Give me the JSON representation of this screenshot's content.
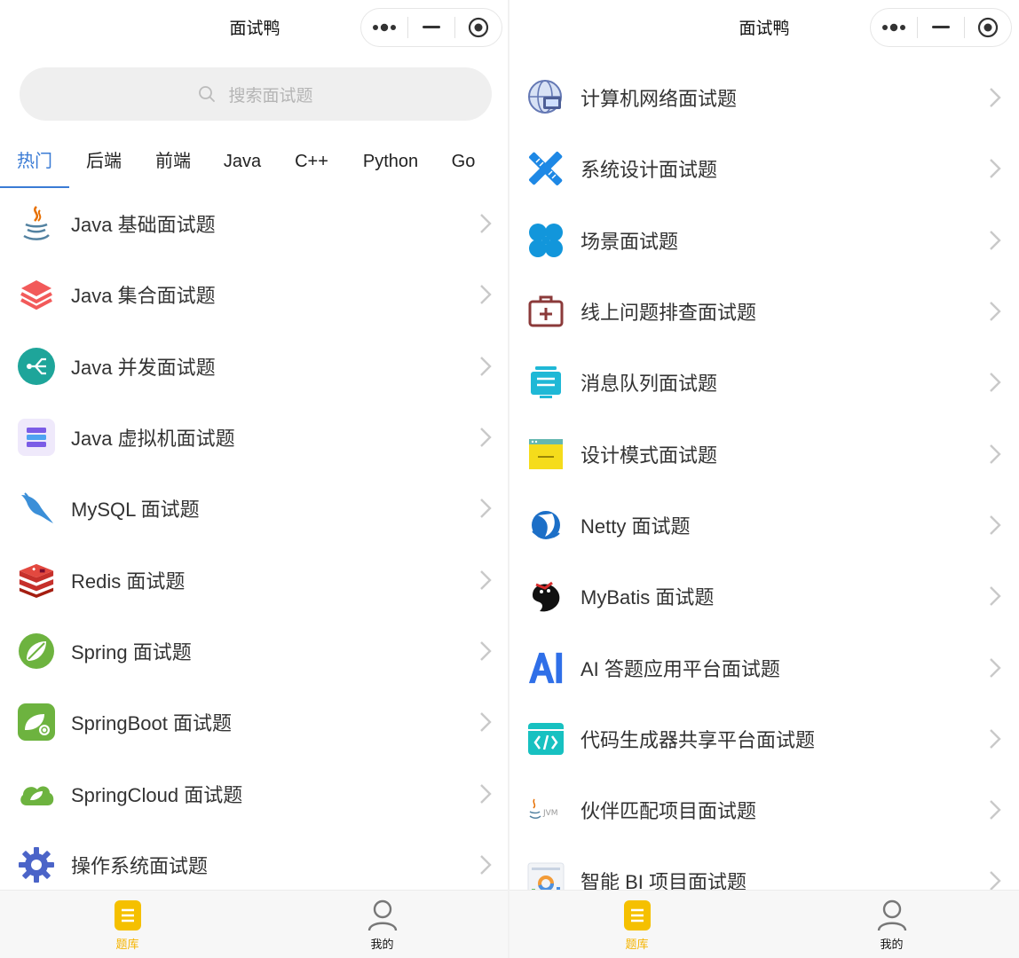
{
  "left": {
    "title": "面试鸭",
    "search": {
      "placeholder": "搜索面试题"
    },
    "tabs": [
      {
        "label": "热门",
        "active": true
      },
      {
        "label": "后端"
      },
      {
        "label": "前端"
      },
      {
        "label": "Java"
      },
      {
        "label": "C++"
      },
      {
        "label": "Python"
      },
      {
        "label": "Go"
      }
    ],
    "items": [
      {
        "label": "Java 基础面试题",
        "icon": "java-cup-icon"
      },
      {
        "label": "Java 集合面试题",
        "icon": "stack-layers-icon"
      },
      {
        "label": "Java 并发面试题",
        "icon": "branch-icon"
      },
      {
        "label": "Java 虚拟机面试题",
        "icon": "server-icon"
      },
      {
        "label": "MySQL 面试题",
        "icon": "mysql-dolphin-icon"
      },
      {
        "label": "Redis 面试题",
        "icon": "redis-icon"
      },
      {
        "label": "Spring 面试题",
        "icon": "spring-leaf-icon"
      },
      {
        "label": "SpringBoot 面试题",
        "icon": "springboot-icon"
      },
      {
        "label": "SpringCloud 面试题",
        "icon": "springcloud-icon"
      },
      {
        "label": "操作系统面试题",
        "icon": "gear-icon"
      }
    ]
  },
  "right": {
    "title": "面试鸭",
    "items": [
      {
        "label": "计算机网络面试题",
        "icon": "network-globe-icon"
      },
      {
        "label": "系统设计面试题",
        "icon": "design-tools-icon"
      },
      {
        "label": "场景面试题",
        "icon": "clover-icon"
      },
      {
        "label": "线上问题排查面试题",
        "icon": "first-aid-kit-icon"
      },
      {
        "label": "消息队列面试题",
        "icon": "message-queue-icon"
      },
      {
        "label": "设计模式面试题",
        "icon": "window-note-icon"
      },
      {
        "label": "Netty 面试题",
        "icon": "netty-icon"
      },
      {
        "label": "MyBatis 面试题",
        "icon": "mybatis-bird-icon"
      },
      {
        "label": "AI 答题应用平台面试题",
        "icon": "ai-text-icon"
      },
      {
        "label": "代码生成器共享平台面试题",
        "icon": "code-window-icon"
      },
      {
        "label": "伙伴匹配项目面试题",
        "icon": "java-jvm-icon"
      },
      {
        "label": "智能 BI 项目面试题",
        "icon": "bi-chart-icon"
      }
    ]
  },
  "tabbar": [
    {
      "label": "题库",
      "icon": "question-bank-icon",
      "active": true
    },
    {
      "label": "我的",
      "icon": "user-icon"
    }
  ],
  "colors": {
    "accent": "#3a7bd5",
    "tabbar_active": "#f5b400",
    "search_bg": "#efefef"
  }
}
